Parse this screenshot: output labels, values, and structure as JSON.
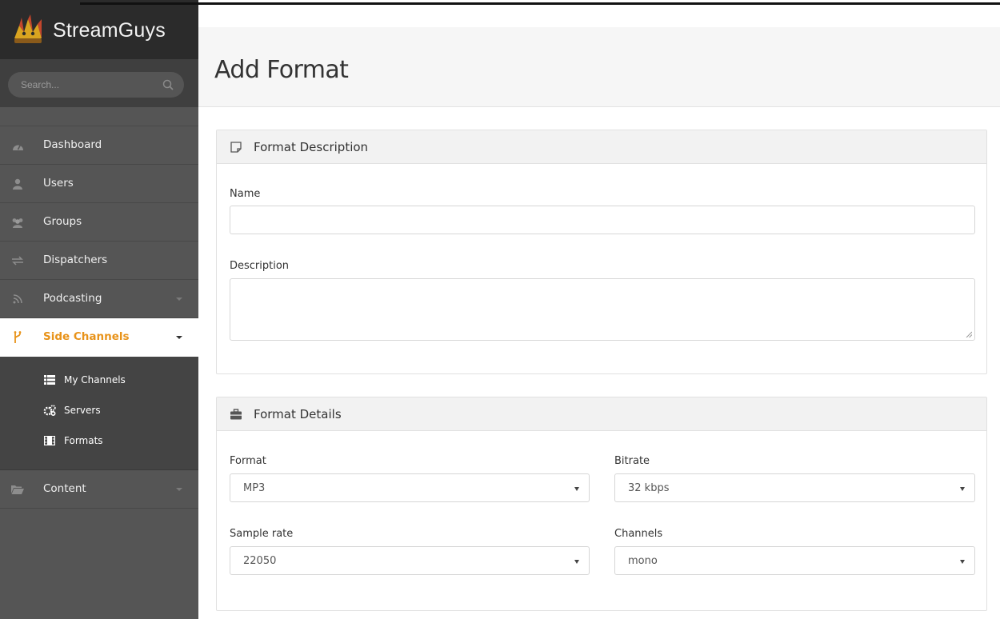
{
  "brand": {
    "name": "StreamGuys"
  },
  "search": {
    "placeholder": "Search..."
  },
  "sidebar": {
    "items": [
      {
        "label": "Dashboard",
        "icon": "dashboard-icon"
      },
      {
        "label": "Users",
        "icon": "user-icon"
      },
      {
        "label": "Groups",
        "icon": "users-icon"
      },
      {
        "label": "Dispatchers",
        "icon": "exchange-icon"
      },
      {
        "label": "Podcasting",
        "icon": "rss-icon"
      },
      {
        "label": "Side Channels",
        "icon": "branch-icon",
        "active": true
      },
      {
        "label": "Content",
        "icon": "folder-open-icon"
      }
    ],
    "subitems": [
      {
        "label": "My Channels",
        "icon": "list-icon"
      },
      {
        "label": "Servers",
        "icon": "cogs-icon"
      },
      {
        "label": "Formats",
        "icon": "film-icon"
      }
    ]
  },
  "page": {
    "title": "Add Format"
  },
  "description_panel": {
    "title": "Format Description",
    "name_label": "Name",
    "name_value": "",
    "description_label": "Description",
    "description_value": ""
  },
  "details_panel": {
    "title": "Format Details",
    "format_label": "Format",
    "format_value": "MP3",
    "bitrate_label": "Bitrate",
    "bitrate_value": "32 kbps",
    "sample_rate_label": "Sample rate",
    "sample_rate_value": "22050",
    "channels_label": "Channels",
    "channels_value": "mono"
  },
  "colors": {
    "accent": "#e8931a",
    "sidebar": "#555555",
    "sidebar_dark": "#2b2b2b",
    "subnav": "#444444"
  }
}
